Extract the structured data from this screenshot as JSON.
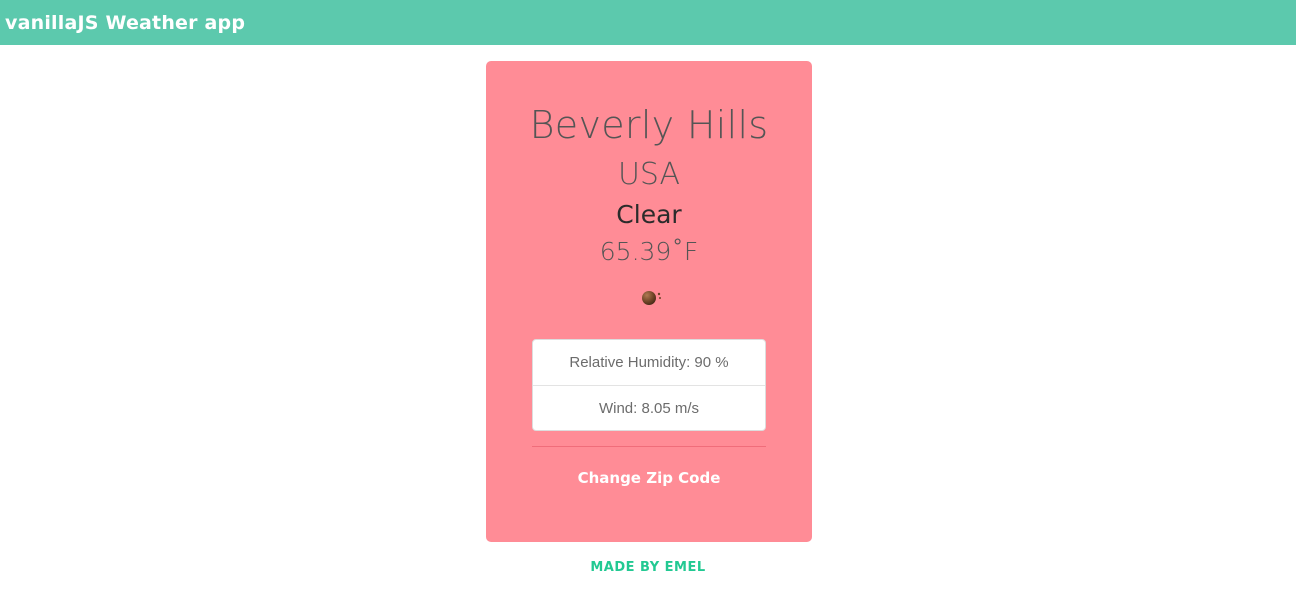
{
  "header": {
    "title": "vanillaJS Weather app"
  },
  "weather": {
    "city": "Beverly Hills",
    "country": "USA",
    "condition": "Clear",
    "temperature": "65.39˚F",
    "icon": "clear-night-moon-icon"
  },
  "stats": {
    "humidity": "Relative Humidity: 90 %",
    "wind": "Wind: 8.05 m/s"
  },
  "actions": {
    "change_zip_label": "Change Zip Code"
  },
  "footer": {
    "credit": "MADE BY EMEL"
  },
  "colors": {
    "header_bg": "#5cc9ad",
    "card_bg": "#ff8c96",
    "credit_text": "#22c992"
  }
}
